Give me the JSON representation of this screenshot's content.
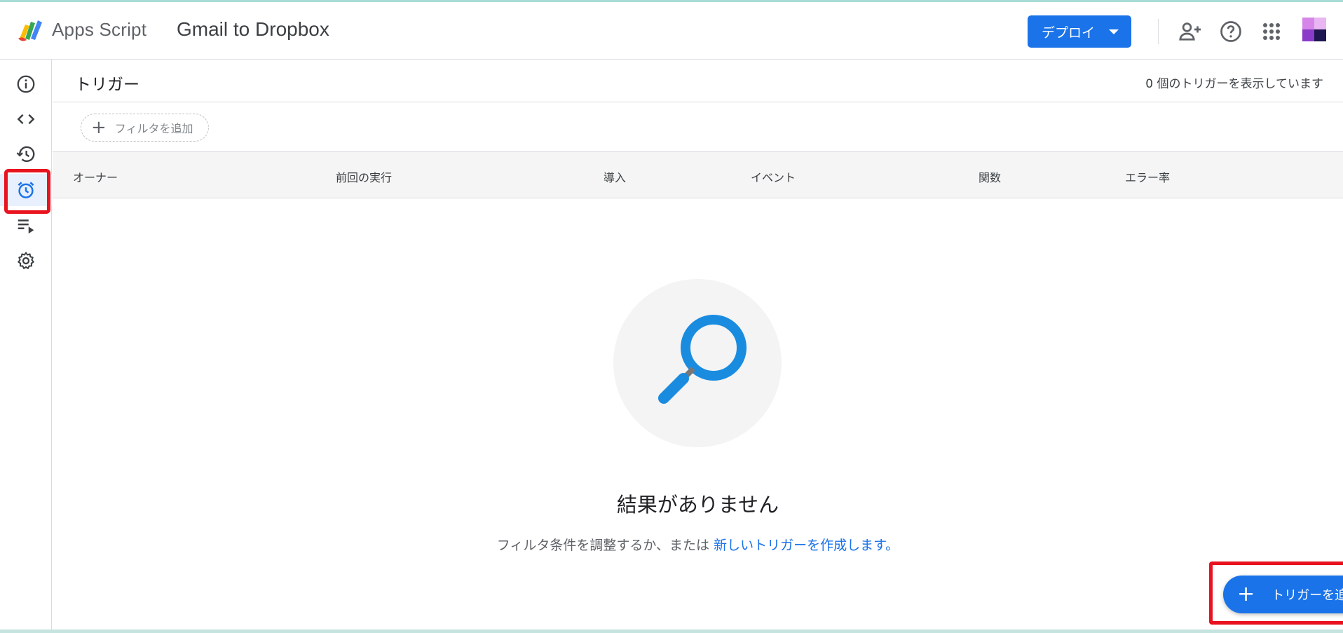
{
  "app": {
    "brand": "Apps Script",
    "project_title": "Gmail to Dropbox"
  },
  "header": {
    "deploy_label": "デプロイ",
    "icons": [
      "person-add-icon",
      "help-icon",
      "apps-grid-icon",
      "avatar"
    ]
  },
  "sidebar": {
    "items": [
      {
        "icon": "info-icon",
        "active": false
      },
      {
        "icon": "code-icon",
        "active": false
      },
      {
        "icon": "history-icon",
        "active": false
      },
      {
        "icon": "alarm-clock-icon",
        "active": true
      },
      {
        "icon": "playlist-play-icon",
        "active": false
      },
      {
        "icon": "gear-icon",
        "active": false
      }
    ]
  },
  "main": {
    "title": "トリガー",
    "trigger_count": "0 個のトリガーを表示しています",
    "filter_label": "フィルタを追加",
    "columns": [
      "オーナー",
      "前回の実行",
      "導入",
      "イベント",
      "関数",
      "エラー率"
    ],
    "empty_title": "結果がありません",
    "empty_desc_prefix": "フィルタ条件を調整するか、または ",
    "empty_desc_link": "新しいトリガーを作成します。",
    "add_trigger_label": "トリガーを追加"
  },
  "colors": {
    "accent": "#1a73e8",
    "highlight": "#e8131f",
    "search_icon": "#1a8ce0"
  }
}
